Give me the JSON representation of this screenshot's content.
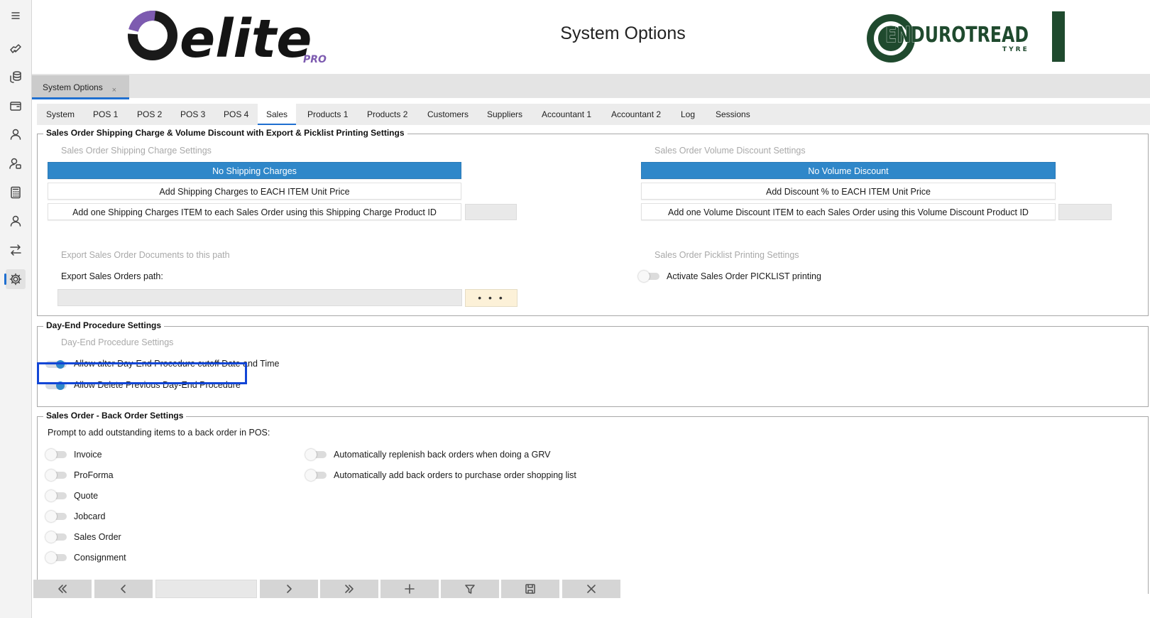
{
  "brand": {
    "logo": "elite",
    "logo_suffix": "PRO",
    "partner_logo_main": "ENDUROTREAD",
    "partner_logo_sub": "TYRE"
  },
  "header": {
    "title": "System Options"
  },
  "document_tab": {
    "label": "System Options",
    "close": "×"
  },
  "rail_icons": [
    "hamburger-menu-icon",
    "handshake-icon",
    "coins-icon",
    "wallet-icon",
    "user-icon",
    "user-settings-icon",
    "calculator-icon",
    "person-icon",
    "transfer-icon",
    "gear-icon"
  ],
  "tabs": [
    "System",
    "POS 1",
    "POS 2",
    "POS 3",
    "POS 4",
    "Sales",
    "Products 1",
    "Products 2",
    "Customers",
    "Suppliers",
    "Accountant 1",
    "Accountant 2",
    "Log",
    "Sessions"
  ],
  "active_tab": "Sales",
  "shipping_group": {
    "title": "Sales Order Shipping Charge & Volume Discount with Export & Picklist Printing Settings",
    "shipping": {
      "subtitle": "Sales Order Shipping Charge Settings",
      "options": [
        "No Shipping Charges",
        "Add Shipping Charges to EACH ITEM Unit Price",
        "Add one Shipping Charges ITEM to each Sales Order using this Shipping Charge Product ID"
      ],
      "selected_index": 0,
      "product_id_value": ""
    },
    "volume": {
      "subtitle": "Sales Order Volume Discount Settings",
      "options": [
        "No Volume Discount",
        "Add Discount % to EACH ITEM Unit Price",
        "Add one Volume Discount ITEM to each Sales Order using this Volume Discount Product ID"
      ],
      "selected_index": 0,
      "product_id_value": ""
    },
    "export": {
      "subtitle": "Export Sales Order Documents to this path",
      "path_label": "Export Sales Orders path:",
      "path_value": "",
      "browse_label": "• • •"
    },
    "picklist": {
      "subtitle": "Sales Order Picklist Printing Settings",
      "toggle_label": "Activate Sales Order PICKLIST printing",
      "toggle_on": false
    }
  },
  "dayend_group": {
    "title": "Day-End Procedure Settings",
    "subtitle": "Day-End Procedure Settings",
    "toggles": [
      {
        "label": "Allow alter Day-End Procedure cutoff Date and Time",
        "on": true
      },
      {
        "label": "Allow Delete Previous Day-End Procedure",
        "on": true
      }
    ]
  },
  "backorder_group": {
    "title": "Sales Order - Back Order Settings",
    "prompt": "Prompt to add outstanding items to a back order in POS:",
    "left_toggles": [
      {
        "label": "Invoice",
        "on": false
      },
      {
        "label": "ProForma",
        "on": false
      },
      {
        "label": "Quote",
        "on": false
      },
      {
        "label": "Jobcard",
        "on": false
      },
      {
        "label": "Sales Order",
        "on": false
      },
      {
        "label": "Consignment",
        "on": false
      }
    ],
    "right_toggles": [
      {
        "label": "Automatically replenish back orders when doing a GRV",
        "on": false
      },
      {
        "label": "Automatically add back orders to purchase order shopping list",
        "on": false
      }
    ]
  },
  "navigation": {
    "buttons": [
      "first-record-icon",
      "previous-record-icon",
      "next-record-icon",
      "last-record-icon",
      "add-icon",
      "filter-icon",
      "save-icon",
      "close-icon"
    ],
    "record_field": ""
  },
  "colors": {
    "accent": "#2f87c9",
    "highlight_border": "#1246d6",
    "tab_underline": "#1f6fd0",
    "brand_purple": "#7d5bb0",
    "brand_green": "#1f4a2e"
  }
}
